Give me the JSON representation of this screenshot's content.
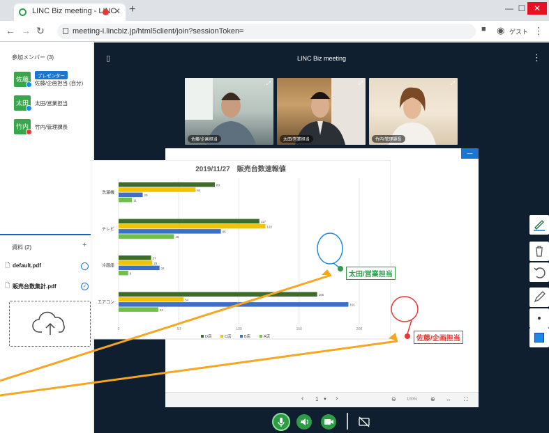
{
  "browser": {
    "tab_title": "LINC Biz meeting - LINC",
    "url": "meeting-i.lincbiz.jp/html5client/join?sessionToken=",
    "profile_label": "ゲスト"
  },
  "sidebar": {
    "members_title": "参加メンバー (3)",
    "presenter_badge": "プレゼンター",
    "members": [
      {
        "avatar": "佐藤",
        "name": "佐藤/企画担当 (自分)",
        "badge_color": "#1e88e5"
      },
      {
        "avatar": "太田",
        "name": "太田/営業担当",
        "badge_color": "#1e88e5"
      },
      {
        "avatar": "竹内",
        "name": "竹内/管理課長",
        "badge_color": "#e53935"
      }
    ],
    "files_title": "資料 (2)",
    "add_label": "+",
    "files": [
      {
        "name": "default.pdf"
      },
      {
        "name": "販売台数集計.pdf"
      }
    ]
  },
  "main": {
    "title": "LINC Biz meeting",
    "videos": [
      {
        "label": "佐藤/企画担当"
      },
      {
        "label": "太田/営業担当"
      },
      {
        "label": "竹内/管理課長"
      }
    ],
    "pager": {
      "page": "1",
      "zoom": "100%"
    },
    "annotations": {
      "ota_label": "太田/営業担当",
      "sato_label": "佐藤/企画担当"
    }
  },
  "chart_data": {
    "type": "bar",
    "orientation": "horizontal",
    "title": "2019/11/27　販売台数速報値",
    "categories": [
      "洗濯機",
      "テレビ",
      "冷蔵庫",
      "エアコン"
    ],
    "series": [
      {
        "name": "D店",
        "color": "#3e6b2a",
        "values": [
          80,
          117,
          27,
          165
        ]
      },
      {
        "name": "C店",
        "color": "#f2c300",
        "values": [
          64,
          122,
          28,
          54
        ]
      },
      {
        "name": "B店",
        "color": "#3d6fc4",
        "values": [
          20,
          85,
          34,
          191
        ]
      },
      {
        "name": "A店",
        "color": "#6fbf4a",
        "values": [
          11,
          46,
          8,
          33
        ]
      }
    ],
    "xlim": [
      0,
      200
    ],
    "xticks": [
      "0",
      "50",
      "100",
      "150",
      "200"
    ],
    "legend": "bottom"
  }
}
